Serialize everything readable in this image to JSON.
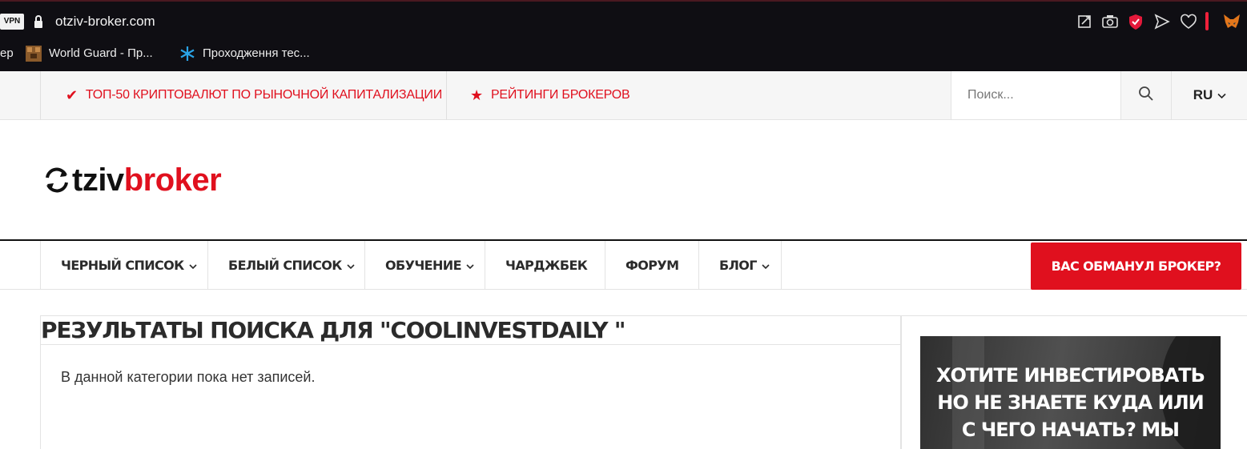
{
  "browser": {
    "vpn_badge": "VPN",
    "url": "otziv-broker.com",
    "bookmarks": [
      {
        "label": "ер"
      },
      {
        "label": "World Guard - Пр..."
      },
      {
        "label": "Проходження тес..."
      }
    ]
  },
  "topbar": {
    "links": [
      {
        "label": "ТОП-50 КРИПТОВАЛЮТ ПО РЫНОЧНОЙ КАПИТАЛИЗАЦИИ",
        "icon": "check-icon"
      },
      {
        "label": "РЕЙТИНГИ БРОКЕРОВ",
        "icon": "star-icon"
      }
    ],
    "search_placeholder": "Поиск...",
    "language": "RU"
  },
  "logo": {
    "part_black": "tziv",
    "part_red": "broker"
  },
  "nav": {
    "items": [
      {
        "label": "ЧЕРНЫЙ СПИСОК",
        "has_dropdown": true
      },
      {
        "label": "БЕЛЫЙ СПИСОК",
        "has_dropdown": true
      },
      {
        "label": "ОБУЧЕНИЕ",
        "has_dropdown": true
      },
      {
        "label": "ЧАРДЖБЕК",
        "has_dropdown": false
      },
      {
        "label": "ФОРУМ",
        "has_dropdown": false
      },
      {
        "label": "БЛОГ",
        "has_dropdown": true
      }
    ],
    "cta": "ВАС ОБМАНУЛ БРОКЕР?"
  },
  "main": {
    "title": "РЕЗУЛЬТАТЫ ПОИСКА ДЛЯ \"COOLINVESTDAILY \"",
    "empty_message": "В данной категории пока нет записей."
  },
  "sidebar": {
    "promo_lines": [
      "ХОТИТЕ ИНВЕСТИРОВАТЬ",
      "НО НЕ ЗНАЕТЕ КУДА ИЛИ",
      "С ЧЕГО НАЧАТЬ? МЫ"
    ]
  },
  "colors": {
    "accent": "#e0101e",
    "chrome_bg": "#0f0e13",
    "text_dark": "#2b2b2b"
  }
}
